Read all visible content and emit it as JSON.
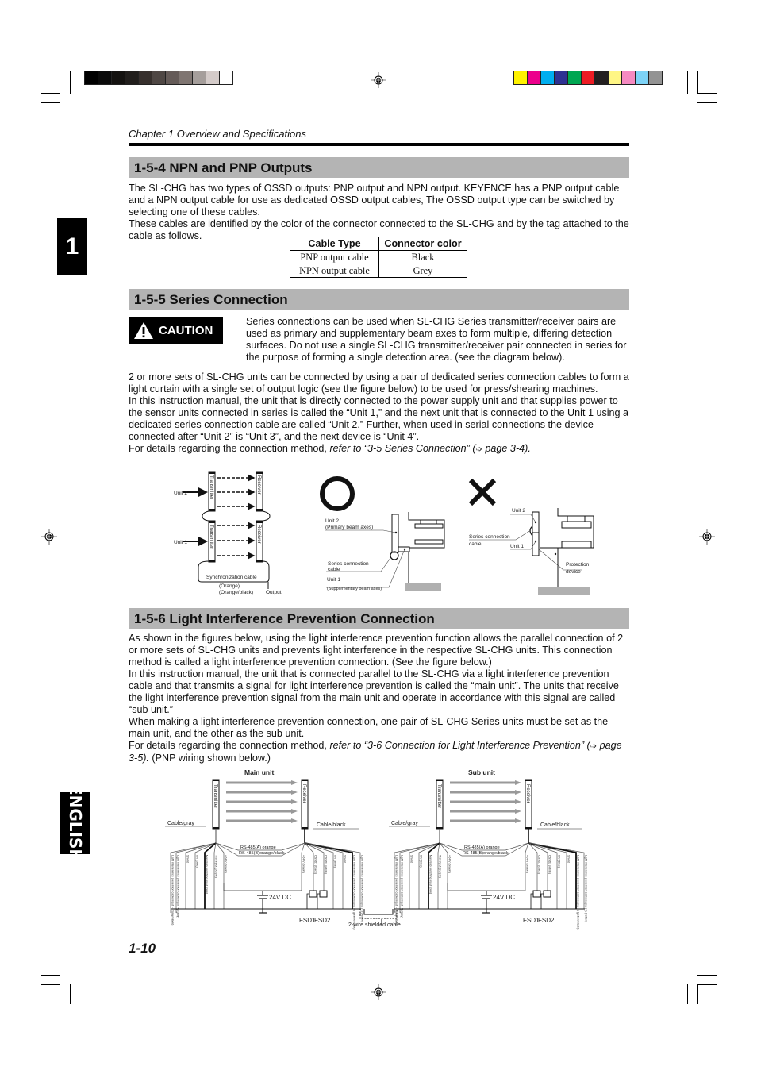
{
  "printer_marks": {
    "grayscale_swatches": [
      "#000000",
      "#0a0a0a",
      "#141210",
      "#211e1c",
      "#37302d",
      "#4f4744",
      "#655b58",
      "#7f7571",
      "#a59e9b",
      "#d4cbc9",
      "#ffffff"
    ],
    "color_swatches": [
      "#fff200",
      "#ec008c",
      "#00aeef",
      "#2e3192",
      "#00a651",
      "#ed1c24",
      "#231f20",
      "#fff685",
      "#f58ac1",
      "#7dd3f7",
      "#939393"
    ]
  },
  "side_tabs": {
    "chapter_number": "1",
    "language": "ENGLISH"
  },
  "header": {
    "chapter_title": "Chapter 1  Overview and Specifications"
  },
  "sections": {
    "npn_pnp": {
      "title": "1-5-4 NPN and PNP Outputs",
      "body": [
        "The SL-CHG has two types of OSSD outputs: PNP output and NPN output.  KEYENCE has a PNP output cable and a NPN output cable for use as dedicated OSSD output cables, The OSSD output type can be switched by selecting one of these cables.",
        "These cables are identified by the color of the connector connected to the SL-CHG and by the tag attached to the cable as follows."
      ],
      "table": {
        "headers": [
          "Cable Type",
          "Connector color"
        ],
        "rows": [
          [
            "PNP output cable",
            "Black"
          ],
          [
            "NPN output cable",
            "Grey"
          ]
        ]
      }
    },
    "series": {
      "title": "1-5-5 Series Connection",
      "caution_label": "CAUTION",
      "caution_text": "Series connections can be used when SL-CHG Series transmitter/receiver pairs are used as primary and supplementary beam axes to form multiple, differing detection surfaces. Do not use a single SL-CHG transmitter/receiver pair connected in series for the purpose of forming a single detection area. (see the diagram below).",
      "body": [
        "2 or more sets of SL-CHG units can be connected by using a pair of dedicated series connection cables to form a light curtain with a single set of output logic (see the figure below) to be used for press/shearing machines.",
        "In this instruction manual, the unit that is directly connected to the power supply unit and that supplies power to the sensor units connected in series is called the “Unit 1,” and the next unit that is connected to the Unit 1 using a dedicated series connection cable are called “Unit 2.” Further, when used in serial connections the device connected after “Unit 2” is “Unit 3”, and the next device is “Unit 4”."
      ],
      "ref_prefix": "For details regarding the connection method, ",
      "ref_italic": "refer to “3-5 Series Connection” (",
      "ref_arrow": "➩",
      "ref_page": " page 3-4).",
      "figure1": {
        "unit2": "Unit 2",
        "unit1": "Unit 1",
        "transmitter": "Transmitter",
        "receiver": "Receiver",
        "sync_cable": "Synchronization cable",
        "orange": "(Orange)",
        "orange_black": "(Orange/black)",
        "output": "Output"
      },
      "figure2": {
        "unit2": "Unit 2",
        "unit2_sub": "(Primary beam axes)",
        "cable": "Series connection",
        "cable2": "cable",
        "unit1": "Unit 1",
        "unit1_sub": "(Supplementary beam axes)"
      },
      "figure3": {
        "unit2": "Unit 2",
        "cable": "Series connection",
        "cable2": "cable",
        "unit1": "Unit 1",
        "protection": "Protection",
        "protection2": "device"
      }
    },
    "interference": {
      "title": "1-5-6 Light Interference Prevention Connection",
      "body": [
        "As shown in the figures below, using the light interference prevention function allows the parallel connection of 2 or more sets of SL-CHG units and prevents light interference in the respective SL-CHG units. This connection method is called a light interference prevention connection. (See the figure below.)",
        "In this instruction manual, the unit that is connected parallel to the SL-CHG via a light interference prevention cable and that transmits a signal for light interference prevention is called the “main unit”. The units that receive the light interference prevention signal from the main unit and operate in accordance with this signal are called “sub unit.”",
        "When making a light interference prevention connection, one pair of SL-CHG Series units must be set as the main unit, and the other as the sub unit."
      ],
      "ref_prefix": "For details regarding the connection method, ",
      "ref_italic": "refer to “3-6 Connection for Light Interference Prevention” (",
      "ref_arrow": "➩",
      "ref_page": " page 3-5).",
      "ref_suffix": " (PNP wiring shown below.)",
      "wiring": {
        "main_unit": "Main unit",
        "sub_unit": "Sub unit",
        "transmitter": "Transmitter",
        "receiver": "Receiver",
        "cable_gray": "Cable/gray",
        "cable_black": "Cable/black",
        "rs485a": "RS-485(A) orange",
        "rs485b": "RS-485(B)orange/black",
        "tx_wires": [
          "Light interference prevention cable input (-) (gray/black)",
          "Light interference prevention cable input (+) (gray)",
          "Shield",
          "0 V (blue)",
          "Main/sub switching input (pink)",
          "Test input (purple)",
          "+24 V (brown)"
        ],
        "rx_wires": [
          "+24 V (brown)",
          "OSSD1 (black)",
          "OSSD2 (white)",
          "0 V (Blue)",
          "Shield",
          "Light interference prevention cable output (-) (yellow/black)",
          "Light interference prevention cable output (+) (yellow)"
        ],
        "supply": "24V DC",
        "fsd1": "FSD1",
        "fsd2": "FSD2",
        "shielded_cable": "2-wire shielded cable"
      }
    }
  },
  "footer": {
    "page_number": "1-10"
  }
}
